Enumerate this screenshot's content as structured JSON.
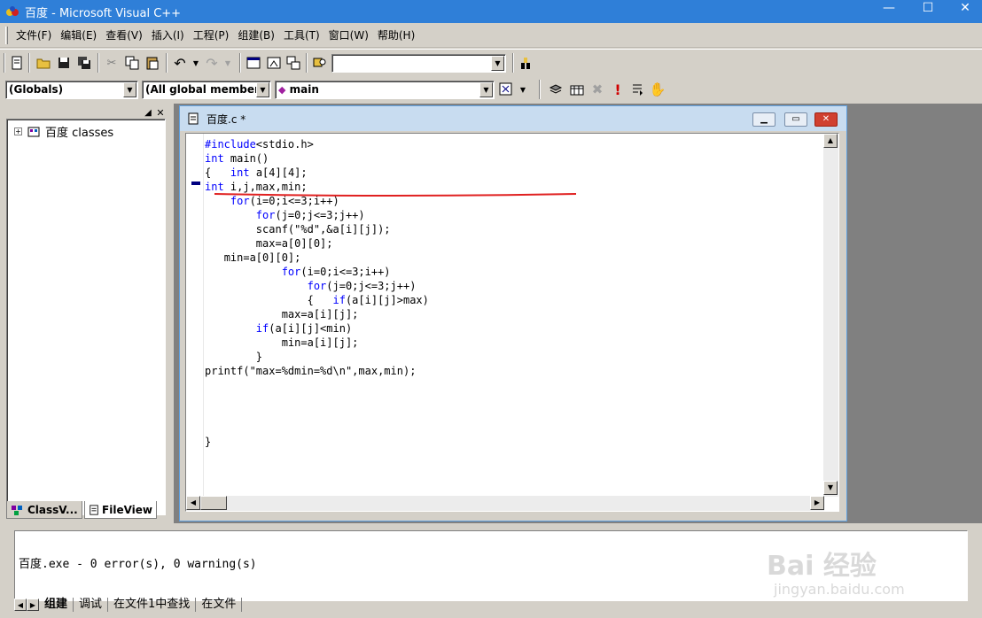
{
  "window": {
    "title": "百度 - Microsoft Visual C++",
    "minimize": "—",
    "maximize": "☐",
    "close": "✕"
  },
  "menu": [
    "文件(F)",
    "编辑(E)",
    "查看(V)",
    "插入(I)",
    "工程(P)",
    "组建(B)",
    "工具(T)",
    "窗口(W)",
    "帮助(H)"
  ],
  "toolbar": {
    "find_value": "",
    "scope_combo": "(Globals)",
    "members_combo": "(All global members",
    "function_combo": "main"
  },
  "workspace": {
    "tree_root": "百度 classes",
    "tab_classview": "ClassV...",
    "tab_fileview": "FileView"
  },
  "editor": {
    "title": "百度.c *",
    "code_lines": [
      {
        "kw": "#include",
        "rest": "<stdio.h>"
      },
      {
        "kw": "int",
        "rest": " main()"
      },
      {
        "pre": "{   ",
        "kw": "int",
        "rest": " a[4][4];"
      },
      {
        "kw": "int",
        "rest": " i,j,max,min;"
      },
      {
        "pre": "    ",
        "kw": "for",
        "rest": "(i=0;i<=3;i++)"
      },
      {
        "pre": "        ",
        "kw": "for",
        "rest": "(j=0;j<=3;j++)"
      },
      {
        "pre": "        ",
        "rest": "scanf(\"%d\",&a[i][j]);"
      },
      {
        "pre": "        ",
        "rest": "max=a[0][0];"
      },
      {
        "pre": "   ",
        "rest": "min=a[0][0];"
      },
      {
        "pre": "            ",
        "kw": "for",
        "rest": "(i=0;i<=3;i++)"
      },
      {
        "pre": "                ",
        "kw": "for",
        "rest": "(j=0;j<=3;j++)"
      },
      {
        "pre": "                {   ",
        "kw": "if",
        "rest": "(a[i][j]>max)"
      },
      {
        "pre": "            ",
        "rest": "max=a[i][j];"
      },
      {
        "pre": "        ",
        "kw": "if",
        "rest": "(a[i][j]<min)"
      },
      {
        "pre": "            ",
        "rest": "min=a[i][j];"
      },
      {
        "pre": "        ",
        "rest": "}"
      },
      {
        "rest": "printf(\"max=%dmin=%d\\n\",max,min);"
      },
      {
        "rest": ""
      },
      {
        "rest": ""
      },
      {
        "rest": ""
      },
      {
        "rest": ""
      },
      {
        "rest": "}"
      }
    ]
  },
  "output": {
    "line": "百度.exe - 0 error(s), 0 warning(s)",
    "tabs": [
      "组建",
      "调试",
      "在文件1中查找",
      "在文件"
    ]
  },
  "watermark": {
    "main": "Bai 经验",
    "sub": "jingyan.baidu.com"
  },
  "colors": {
    "titlebar": "#2f7fd8",
    "keyword": "#0000ff",
    "annotation_line": "#e02020"
  }
}
